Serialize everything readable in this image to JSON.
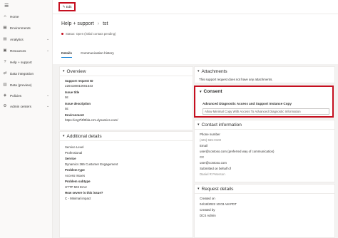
{
  "nav": {
    "items": [
      {
        "icon": "home-icon",
        "glyph": "⌂",
        "label": "Home",
        "chevron": ""
      },
      {
        "icon": "environments-icon",
        "glyph": "▦",
        "label": "Environments",
        "chevron": ""
      },
      {
        "icon": "analytics-icon",
        "glyph": "▤",
        "label": "Analytics",
        "chevron": "⌄"
      },
      {
        "icon": "resources-icon",
        "glyph": "▣",
        "label": "Resources",
        "chevron": "⌄"
      },
      {
        "icon": "help-support-icon",
        "glyph": "?",
        "label": "Help + support",
        "chevron": ""
      },
      {
        "icon": "data-integration-icon",
        "glyph": "⇄",
        "label": "Data integration",
        "chevron": ""
      },
      {
        "icon": "data-preview-icon",
        "glyph": "▥",
        "label": "Data (preview)",
        "chevron": ""
      },
      {
        "icon": "policies-icon",
        "glyph": "◈",
        "label": "Policies",
        "chevron": "⌄"
      },
      {
        "icon": "admin-centers-icon",
        "glyph": "⚙",
        "label": "Admin centers",
        "chevron": "⌄"
      }
    ]
  },
  "toolbar": {
    "edit_label": "Edit"
  },
  "header": {
    "breadcrumb_root": "Help + support",
    "breadcrumb_sep": "›",
    "breadcrumb_current": "tst",
    "status": "Status: Open (initial contact pending)"
  },
  "tabs": [
    {
      "label": "Details",
      "active": true
    },
    {
      "label": "Communication history",
      "active": false
    }
  ],
  "overview": {
    "title": "Overview",
    "support_request_id_label": "Support request ID",
    "support_request_id": "2204180010001543",
    "issue_title_label": "Issue title",
    "issue_title": "tst",
    "issue_description_label": "Issue description",
    "issue_description": "tst",
    "environment_label": "Environment",
    "environment": "https://org7f4f0fda.crm.dynamics.com/"
  },
  "additional": {
    "title": "Additional details",
    "service_level_label": "Service Level",
    "service_level": "Professional",
    "service_label": "Service",
    "service": "Dynamics 365 Customer Engagement",
    "problem_type_label": "Problem type",
    "problem_type": "Access Issues",
    "problem_subtype_label": "Problem subtype",
    "problem_subtype": "HTTP 503 Error",
    "severity_label": "How severe is this issue?",
    "severity": "C - Minimal impact"
  },
  "attachments": {
    "title": "Attachments",
    "text": "This support request does not have any attachments."
  },
  "consent": {
    "title": "Consent",
    "item_title": "Advanced Diagnostic Access and Support Instance Copy",
    "checkbox_text": "Allow Minimal Copy With Access To Advanced Diagnostic Information"
  },
  "contact": {
    "title": "Contact information",
    "phone_label": "Phone number",
    "phone": "(425) 555-0100",
    "email_label": "Email",
    "email": "user@contoso.com (preferred way of communication)",
    "cc_label": "CC",
    "cc": "user@contoso.com",
    "submitted_label": "Submitted on behalf of",
    "submitted": "Daniel R Peterson"
  },
  "request": {
    "title": "Request details",
    "created_label": "Created on",
    "created": "04/18/2022 10:03 AM PDT",
    "created_by_label": "Created by",
    "created_by": "DCS Admin"
  },
  "colors": {
    "accent": "#0078d4",
    "highlight": "#c50f1f"
  }
}
